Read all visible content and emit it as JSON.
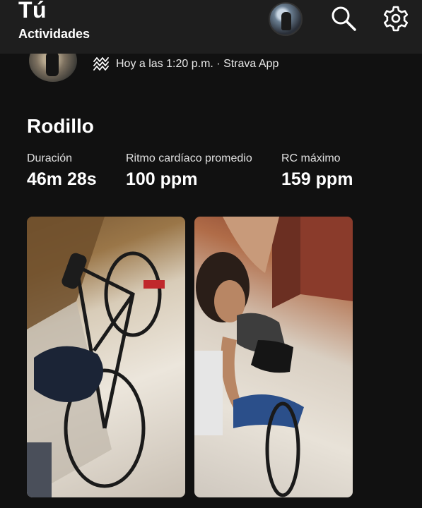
{
  "header": {
    "title": "Tú",
    "subtitle": "Actividades",
    "icons": [
      "profile-avatar",
      "search-icon",
      "gear-icon"
    ]
  },
  "activity": {
    "meta": "Hoy a las 1:20 p.m. · Strava App",
    "title": "Rodillo",
    "stats": [
      {
        "label": "Duración",
        "value": "46m 28s"
      },
      {
        "label": "Ritmo cardíaco promedio",
        "value": "100 ppm"
      },
      {
        "label": "RC máximo",
        "value": "159 ppm"
      }
    ],
    "photos": [
      "bike-on-trainer-photo",
      "rider-selfie-photo"
    ]
  },
  "colors": {
    "background": "#111111",
    "header": "#1e1e1e",
    "text": "#ffffff"
  }
}
